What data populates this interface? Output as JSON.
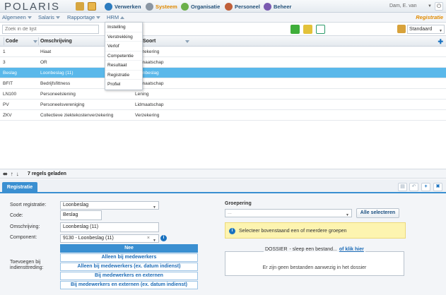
{
  "app": {
    "logo": "POLARIS"
  },
  "top_nav": [
    {
      "label": "Verwerken",
      "icon": "process-icon",
      "active": false
    },
    {
      "label": "Systeem",
      "icon": "gear-icon",
      "active": true
    },
    {
      "label": "Organisatie",
      "icon": "organisation-icon",
      "active": false
    },
    {
      "label": "Personeel",
      "icon": "people-icon",
      "active": false
    },
    {
      "label": "Beheer",
      "icon": "admin-icon",
      "active": false
    }
  ],
  "user": {
    "name": "Dam, E. van"
  },
  "menubar": {
    "items": [
      "Algemeen",
      "Salaris",
      "Rapportage",
      "HRM"
    ],
    "crumb": "Registratie"
  },
  "hrm_menu": [
    "Instelling",
    "Verstrekking",
    "Verlof",
    "Competentie",
    "Resultaat",
    "Registratie",
    "Profiel"
  ],
  "toolbar": {
    "search_placeholder": "Zoek in de lijst",
    "view_value": "Standaard"
  },
  "grid": {
    "columns": [
      "Code",
      "Omschrijving",
      "Soort"
    ],
    "rows": [
      {
        "code": "1",
        "omschrijving": "Hiaat",
        "soort": "Verzekering",
        "selected": false
      },
      {
        "code": "3",
        "omschrijving": "OR",
        "soort": "Lidmaatschap",
        "selected": false
      },
      {
        "code": "Beslag",
        "omschrijving": "Loonbeslag (11)",
        "soort": "Loonbeslag",
        "selected": true
      },
      {
        "code": "BFIT",
        "omschrijving": "Bedrijfsfittness",
        "soort": "Lidmaatschap",
        "selected": false
      },
      {
        "code": "LN100",
        "omschrijving": "Personeelslening",
        "soort": "Lening",
        "selected": false
      },
      {
        "code": "PV",
        "omschrijving": "Personeelsvereniging",
        "soort": "Lidmaatschap",
        "selected": false
      },
      {
        "code": "ZKV",
        "omschrijving": "Collectieve ziektekostenverzekering",
        "soort": "Verzekering",
        "selected": false
      }
    ],
    "footer_count": "7 regels geladen"
  },
  "detail": {
    "tab": "Registratie",
    "labels": {
      "soort": "Soort registratie:",
      "code": "Code:",
      "omschrijving": "Omschrijving:",
      "component": "Component:",
      "toevoegen": "Toevoegen bij indiensttreding:",
      "groepering": "Groepering"
    },
    "values": {
      "soort": "Loonbeslag",
      "code": "Beslag",
      "omschrijving": "Loonbeslag (11)",
      "component": "9130 - Loonbeslag (11)",
      "groepering": "..."
    },
    "toevoegen_options": [
      {
        "label": "Nee",
        "selected": true
      },
      {
        "label": "Alleen bij medewerkers",
        "selected": false
      },
      {
        "label": "Alleen bij medewerkers (ex. datum indienst)",
        "selected": false
      },
      {
        "label": "Bij medewerkers en externen",
        "selected": false
      },
      {
        "label": "Bij medewerkers en externen (ex. datum indienst)",
        "selected": false
      }
    ],
    "select_all": "Alle selecteren",
    "notice": "Selecteer bovenstaand een of meerdere groepen",
    "dossier": {
      "title": "DOSSIER",
      "drop_text": "- sleep een bestand...",
      "link": "of klik hier",
      "empty": "Er zijn geen bestanden aanwezig in het dossier"
    }
  },
  "colors": {
    "accent": "#3a8fd1",
    "selected_row": "#5ab8ea",
    "active_nav": "#e08a00",
    "notice_bg": "#fdf4b0"
  }
}
